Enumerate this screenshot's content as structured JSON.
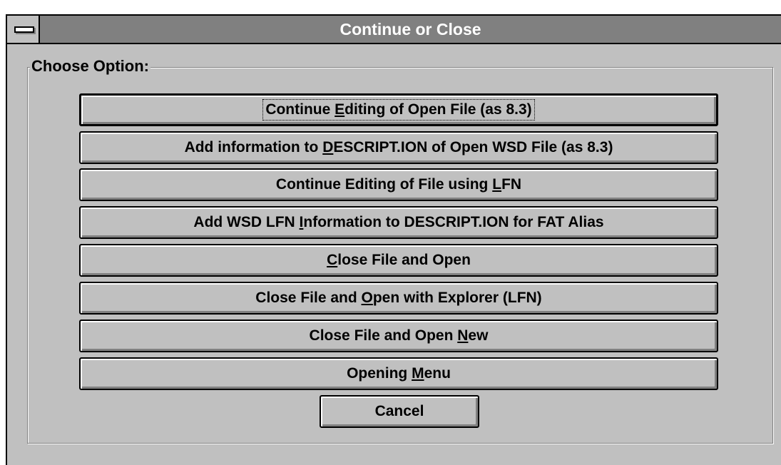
{
  "window": {
    "title": "Continue or Close"
  },
  "group": {
    "label": "Choose Option:"
  },
  "buttons": [
    {
      "pre": "Continue ",
      "key": "E",
      "post": "diting of Open File (as 8.3)"
    },
    {
      "pre": "Add information to ",
      "key": "D",
      "post": "ESCRIPT.ION of Open WSD File (as 8.3)"
    },
    {
      "pre": "Continue Editing of File using ",
      "key": "L",
      "post": "FN"
    },
    {
      "pre": "Add WSD LFN ",
      "key": "I",
      "post": "nformation to DESCRIPT.ION for FAT Alias"
    },
    {
      "pre": "",
      "key": "C",
      "post": "lose File and Open"
    },
    {
      "pre": "Close File and ",
      "key": "O",
      "post": "pen with Explorer (LFN)"
    },
    {
      "pre": "Close File and Open ",
      "key": "N",
      "post": "ew"
    },
    {
      "pre": "Opening ",
      "key": "M",
      "post": "enu"
    }
  ],
  "cancel": {
    "label": "Cancel"
  }
}
